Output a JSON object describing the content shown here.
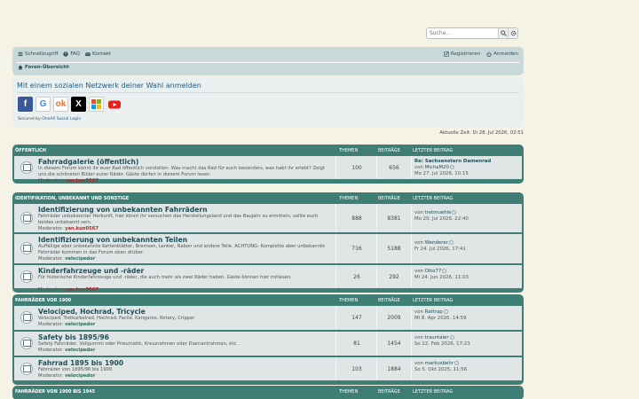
{
  "search": {
    "placeholder": "Suche..."
  },
  "nav": {
    "quick": "Schnellzugriff",
    "faq": "FAQ",
    "contact": "Kontakt",
    "register": "Registrieren",
    "login": "Anmelden",
    "breadcrumb": "Foren-Übersicht"
  },
  "social": {
    "title": "Mit einem sozialen Netzwerk deiner Wahl anmelden",
    "secured_prefix": "Secured by",
    "secured_link": "OneAll Social Login",
    "providers": [
      "Facebook",
      "Google",
      "Odnoklassniki",
      "X",
      "Microsoft",
      "YouTube"
    ]
  },
  "time": "Aktuelle Zeit: Di 28. Jul 2026, 02:51",
  "columns": {
    "topics": "THEMEN",
    "posts": "BEITRÄGE",
    "last": "LETZTER BEITRAG"
  },
  "sections": [
    {
      "title": "ÖFFENTLICH",
      "forums": [
        {
          "title": "Fahrradgalerie (öffentlich)",
          "desc": "In diesem Forum könnt ihr euer Rad öffentlich vorstellen. Was macht das Rad für euch besonders, was habt ihr erlebt? Zeigt uns die schönsten Bilder eurer Räder. Gäste dürfen in diesem Forum lesen.",
          "mod_label": "Moderator:",
          "mod": "yan.kun0567",
          "topics": "100",
          "posts": "656",
          "last_title": "Re: Sachsenstern Damenrad",
          "last_by": "von",
          "last_user": "MichaM20",
          "last_date": "Mo 27. Jul 2026, 10:15"
        }
      ]
    },
    {
      "title": "IDENTIFIKATION, UNBEKANNT UND SONSTIGE",
      "forums": [
        {
          "title": "Identifizierung von unbekannten Fahrrädern",
          "desc": "Fahrräder unbekannter Herkunft, hier könnt ihr versuchen das Herstellungsland und das Baujahr zu ermitteln, sollte euch beides unbekannt sein.",
          "mod_label": "Moderator:",
          "mod": "yan.kun0567",
          "topics": "888",
          "posts": "8381",
          "last_by": "von",
          "last_user": "tretmuehle",
          "last_date": "Mo 20. Jul 2026, 22:40"
        },
        {
          "title": "Identifizierung von unbekannten Teilen",
          "desc": "Auffällige aber unbekannte Kettenblätter, Bremsen, Lenker, Naben und andere Teile. ACHTUNG: Komplette aber unbekannte Fahrräder kommen in das Forum oben drüber.",
          "mod_label": "Moderator:",
          "mod": "velocipedor",
          "topics": "716",
          "posts": "5188",
          "last_by": "von",
          "last_user": "Wenderer",
          "last_date": "Fr 24. Jul 2026, 17:41"
        },
        {
          "title": "Kinderfahrzeuge und -räder",
          "desc": "Für historische Kinderfahrzeuge und -räder, die auch mehr als zwei Räder haben. Gäste können hier mitlesen.",
          "mod_label": "Moderator:",
          "mod": "yan.kun0567",
          "topics": "26",
          "posts": "292",
          "last_by": "von",
          "last_user": "Otto77",
          "last_date": "Mi 24. Jun 2026, 11:03"
        }
      ]
    },
    {
      "title": "FAHRRÄDER VOR 1900",
      "forums": [
        {
          "title": "Velociped, Hochrad, Tricycle",
          "desc": "Velociped, Tretkurbelrad, Hochrad, Facile, Kangaroo, Rotary, Cripper",
          "mod_label": "Moderator:",
          "mod": "velocipedor",
          "topics": "147",
          "posts": "2009",
          "last_by": "von",
          "last_user": "Rattrap",
          "last_date": "Mi 8. Apr 2026, 14:59"
        },
        {
          "title": "Safety bis 1895/96",
          "desc": "Safety Fahrräder, Vollgummi oder Pneumatik, Kreuzrahmen oder Diamantrahmen, etc.",
          "mod_label": "Moderator:",
          "mod": "velocipedor",
          "topics": "81",
          "posts": "1454",
          "last_by": "von",
          "last_user": "trauntaler",
          "last_date": "So 22. Feb 2026, 17:23"
        },
        {
          "title": "Fahrrad 1895 bis 1900",
          "desc": "Fahrräder von 1895/96 bis 1900",
          "mod_label": "Moderator:",
          "mod": "velocipedor",
          "topics": "103",
          "posts": "1884",
          "last_by": "von",
          "last_user": "markusbehr",
          "last_date": "So 5. Okt 2025, 11:56"
        }
      ]
    },
    {
      "title": "FAHRRÄDER VON 1900 BIS 1945",
      "forums": []
    }
  ]
}
